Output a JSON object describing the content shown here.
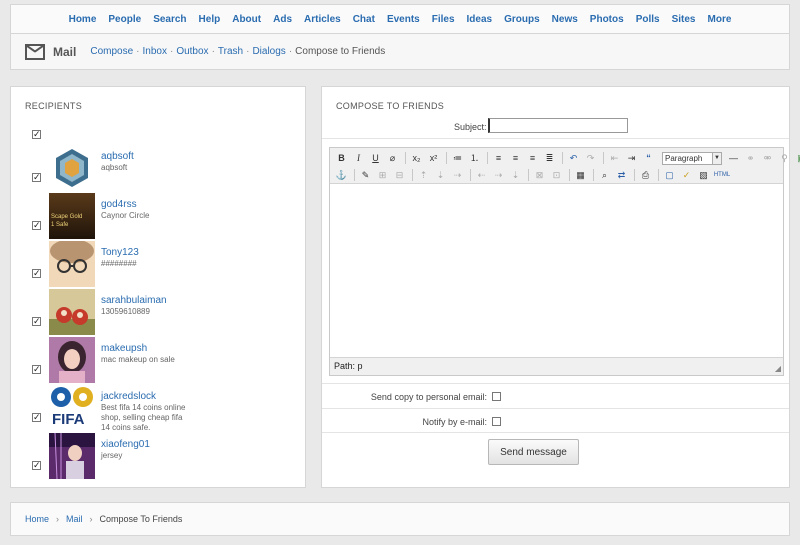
{
  "nav": [
    "Home",
    "People",
    "Search",
    "Help",
    "About",
    "Ads",
    "Articles",
    "Chat",
    "Events",
    "Files",
    "Ideas",
    "Groups",
    "News",
    "Photos",
    "Polls",
    "Sites",
    "More"
  ],
  "mail": {
    "title": "Mail",
    "links": [
      "Compose",
      "Inbox",
      "Outbox",
      "Trash",
      "Dialogs"
    ],
    "current": "Compose to Friends"
  },
  "recipients": {
    "title": "RECIPIENTS",
    "select_all_checked": true,
    "items": [
      {
        "name": "aqbsoft",
        "desc": "aqbsoft",
        "checked": true
      },
      {
        "name": "god4rss",
        "desc": "Caynor Circle",
        "checked": true,
        "avatar_text": "Scape Gold\n1 Safe"
      },
      {
        "name": "Tony123",
        "desc": "########",
        "checked": true
      },
      {
        "name": "sarahbulaiman",
        "desc": "13059610889",
        "checked": true
      },
      {
        "name": "makeupsh",
        "desc": "mac makeup on sale",
        "checked": true
      },
      {
        "name": "jackredslock",
        "desc": "Best fifa 14 coins online shop, selling cheap fifa 14 coins safe.",
        "checked": true,
        "avatar_text": "FIFA"
      },
      {
        "name": "xiaofeng01",
        "desc": "jersey",
        "checked": true
      }
    ]
  },
  "compose": {
    "title": "COMPOSE TO FRIENDS",
    "subject_label": "Subject:",
    "subject_value": "",
    "format_select": "Paragraph",
    "html_button": "HTML",
    "path_label": "Path: p",
    "copy_label": "Send copy to personal email:",
    "notify_label": "Notify by e-mail:",
    "send_label": "Send message"
  },
  "footer": {
    "items": [
      "Home",
      "Mail"
    ],
    "current": "Compose To Friends"
  }
}
